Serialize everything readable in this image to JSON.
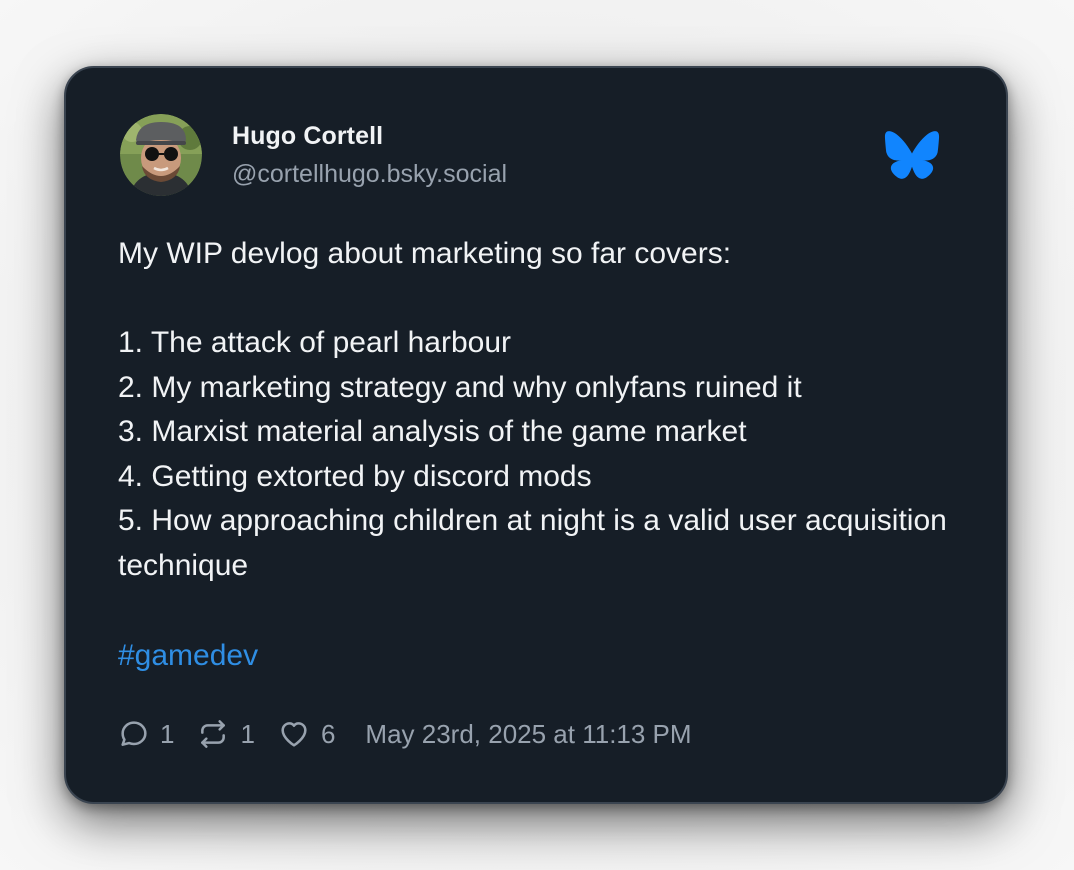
{
  "author": {
    "display_name": "Hugo Cortell",
    "handle": "@cortellhugo.bsky.social",
    "avatar_icon": "avatar-photo"
  },
  "platform": {
    "logo_icon": "bluesky-butterfly-icon",
    "logo_color": "#1185fe"
  },
  "post": {
    "text": "My WIP devlog about marketing so far covers:\n\n1. The attack of pearl harbour\n2. My marketing strategy and why onlyfans ruined it\n3. Marxist material analysis of the game market\n4. Getting extorted by discord mods\n5. How approaching children at night is a valid user acquisition technique",
    "hashtag": "#gamedev",
    "hashtag_color": "#2f8ee4"
  },
  "stats": {
    "replies": "1",
    "reposts": "1",
    "likes": "6",
    "timestamp": "May 23rd, 2025 at 11:13 PM"
  }
}
